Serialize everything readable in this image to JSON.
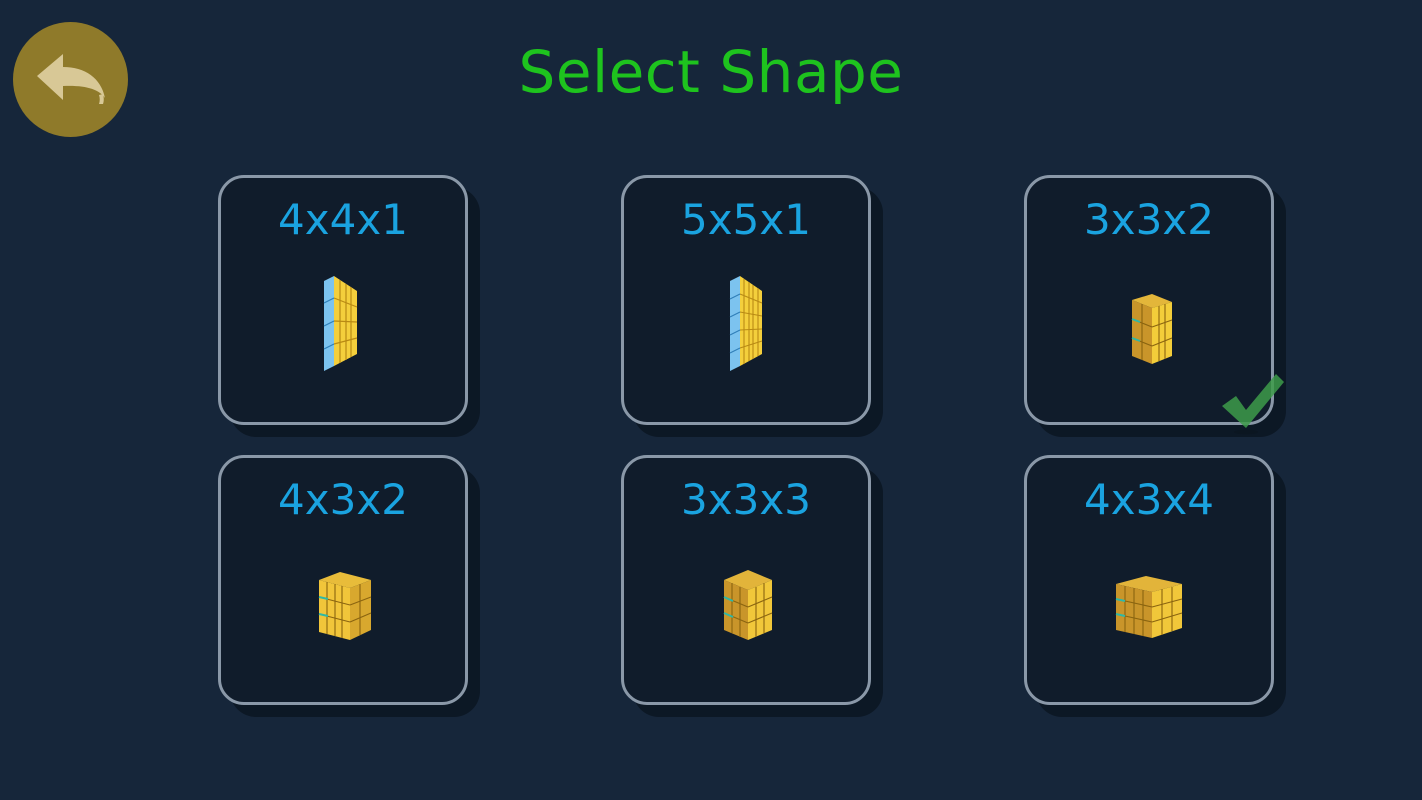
{
  "header": {
    "title": "Select Shape",
    "back_icon": "undo-arrow-icon"
  },
  "colors": {
    "background": "#16263a",
    "title": "#1ec31e",
    "label": "#1aa3e0",
    "card_border": "#8a98a8",
    "back_button": "#8f7a2a",
    "check": "#3d9b4a"
  },
  "shapes": [
    {
      "label": "4x4x1",
      "icon": "flat-cube-4x4x1-icon",
      "selected": false
    },
    {
      "label": "5x5x1",
      "icon": "flat-cube-5x5x1-icon",
      "selected": false
    },
    {
      "label": "3x3x2",
      "icon": "cube-3x3x2-icon",
      "selected": true
    },
    {
      "label": "4x3x2",
      "icon": "cube-4x3x2-icon",
      "selected": false
    },
    {
      "label": "3x3x3",
      "icon": "cube-3x3x3-icon",
      "selected": false
    },
    {
      "label": "4x3x4",
      "icon": "cube-4x3x4-icon",
      "selected": false
    }
  ],
  "selection_icon": "checkmark-icon"
}
